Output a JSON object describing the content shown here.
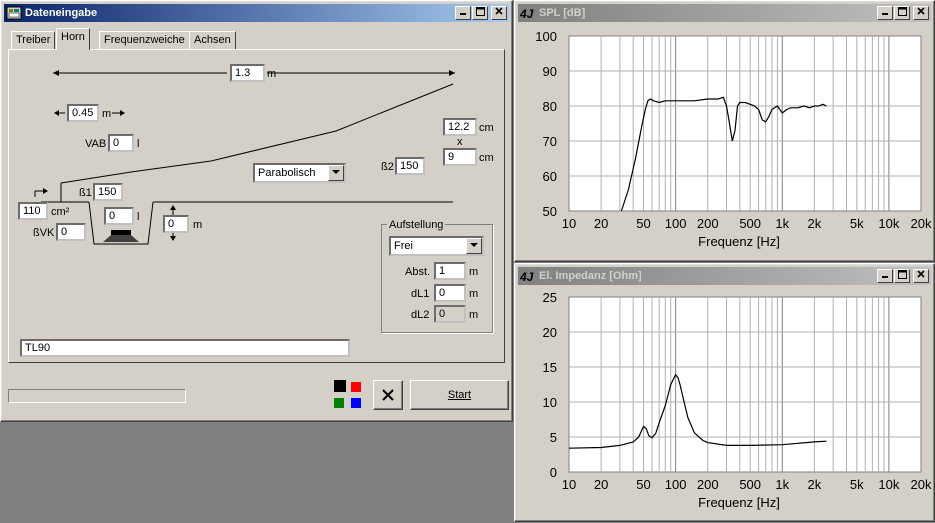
{
  "dialog": {
    "title": "Dateneingabe",
    "tabs": [
      "Treiber",
      "Horn",
      "Frequenzweiche",
      "Achsen"
    ],
    "selected_tab": "Horn",
    "horn": {
      "length_value": "1.3",
      "length_unit": "m",
      "offset_value": "0.45",
      "offset_unit": "m",
      "vab_label": "VAB",
      "vab_value": "0",
      "vab_unit": "l",
      "mouth_width": "12.2",
      "mouth_width_unit": "cm",
      "times_sign": "x",
      "mouth_height": "9",
      "mouth_height_unit": "cm",
      "shape_selected": "Parabolisch",
      "b2_label": "ß2",
      "b2_value": "150",
      "b1_label": "ß1",
      "b1_value": "150",
      "throat_area": "110",
      "throat_area_unit": "cm²",
      "bvk_label": "ßVK",
      "bvk_value": "0",
      "chamber_value": "0",
      "chamber_unit": "l",
      "driver_offset_value": "0",
      "driver_offset_unit": "m",
      "name_value": "TL90"
    },
    "aufstellung": {
      "title": "Aufstellung",
      "selected": "Frei",
      "abst_label": "Abst.",
      "abst_value": "1",
      "abst_unit": "m",
      "dl1_label": "dL1",
      "dl1_value": "0",
      "dl1_unit": "m",
      "dl2_label": "dL2",
      "dl2_value": "0",
      "dl2_unit": "m"
    },
    "colors": [
      "#000000",
      "#ff0000",
      "#008000",
      "#0000ff"
    ],
    "cancel_icon": "x-icon",
    "start_label": "Start",
    "progress": 0
  },
  "spl_window": {
    "title": "SPL [dB]",
    "xlabel": "Frequenz [Hz]"
  },
  "imp_window": {
    "title": "El. Impedanz [Ohm]",
    "xlabel": "Frequenz [Hz]"
  },
  "chart_data": [
    {
      "type": "line",
      "title": "SPL [dB]",
      "xlabel": "Frequenz [Hz]",
      "ylabel": "",
      "xscale": "log",
      "xlim": [
        10,
        20000
      ],
      "ylim": [
        50,
        100
      ],
      "x_ticks": [
        "10",
        "20",
        "50",
        "100",
        "200",
        "500",
        "1k",
        "2k",
        "5k",
        "10k",
        "20k"
      ],
      "y_ticks": [
        "100",
        "90",
        "80",
        "70",
        "60",
        "50"
      ],
      "grid": true,
      "series": [
        {
          "x": [
            31,
            36,
            42,
            48,
            52,
            55,
            58,
            62,
            70,
            80,
            100,
            150,
            200,
            250,
            280,
            300,
            320,
            340,
            360,
            380,
            400,
            450,
            500,
            550,
            600,
            650,
            700,
            750,
            800,
            900,
            1000,
            1100,
            1200,
            1400,
            1600,
            1800,
            2000,
            2200,
            2400,
            2600
          ],
          "y": [
            50,
            56,
            65,
            74,
            79,
            81.5,
            82,
            81.5,
            81,
            81.5,
            81.5,
            81.5,
            82,
            82,
            82.5,
            80,
            75,
            70,
            73,
            80,
            81,
            81,
            80.5,
            80,
            79,
            76,
            75.5,
            77,
            79,
            80,
            78,
            79,
            79.5,
            79.5,
            80,
            79.5,
            80,
            80,
            80.5,
            80
          ]
        }
      ]
    },
    {
      "type": "line",
      "title": "El. Impedanz [Ohm]",
      "xlabel": "Frequenz [Hz]",
      "ylabel": "",
      "xscale": "log",
      "xlim": [
        10,
        20000
      ],
      "ylim": [
        0,
        25
      ],
      "x_ticks": [
        "10",
        "20",
        "50",
        "100",
        "200",
        "500",
        "1k",
        "2k",
        "5k",
        "10k",
        "20k"
      ],
      "y_ticks": [
        "25",
        "20",
        "15",
        "10",
        "5",
        "0"
      ],
      "grid": true,
      "series": [
        {
          "x": [
            10,
            20,
            30,
            40,
            45,
            50,
            53,
            56,
            60,
            65,
            70,
            80,
            90,
            100,
            105,
            110,
            120,
            130,
            150,
            180,
            200,
            300,
            500,
            1000,
            2000,
            2600
          ],
          "y": [
            3.4,
            3.5,
            3.8,
            4.3,
            5.0,
            6.5,
            6.2,
            5.2,
            4.9,
            5.5,
            7.0,
            9.5,
            12.5,
            13.9,
            13.5,
            12.5,
            10,
            7.8,
            5.6,
            4.5,
            4.2,
            3.8,
            3.8,
            3.9,
            4.3,
            4.4
          ]
        }
      ]
    }
  ]
}
